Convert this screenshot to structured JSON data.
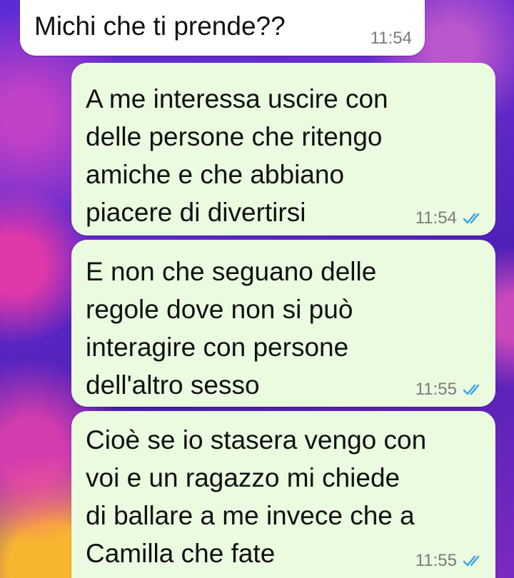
{
  "messages": [
    {
      "direction": "incoming",
      "text": "Michi che ti prende??",
      "time": "11:54",
      "read": false
    },
    {
      "direction": "outgoing",
      "text": "A me interessa uscire con\ndelle persone che ritengo\namiche e che abbiano\npiacere di divertirsi",
      "time": "11:54",
      "read": true
    },
    {
      "direction": "outgoing",
      "text": "E non che seguano delle\nregole dove non si può\ninteragire con persone\ndell'altro sesso",
      "time": "11:55",
      "read": true
    },
    {
      "direction": "outgoing",
      "text": "Cioè se io stasera vengo con\nvoi e un ragazzo mi chiede\ndi ballare a me invece che a\nCamilla che fate",
      "time": "11:55",
      "read": true
    }
  ],
  "icons": {
    "read_receipt": "double-check-icon"
  },
  "colors": {
    "incoming_bubble": "#ffffff",
    "outgoing_bubble": "#eafbe0",
    "read_tick": "#3aa3e8",
    "timestamp": "#7b7b7b"
  }
}
